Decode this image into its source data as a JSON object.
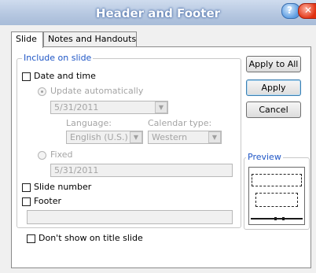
{
  "window": {
    "title": "Header and Footer"
  },
  "tabs": [
    {
      "label": "Slide",
      "active": true
    },
    {
      "label": "Notes and Handouts",
      "active": false
    }
  ],
  "include_group": {
    "legend": "Include on slide",
    "date_time": {
      "label": "Date and time",
      "checked": false,
      "update_auto_label": "Update automatically",
      "date_value": "5/31/2011",
      "language_label": "Language:",
      "language_value": "English (U.S.)",
      "calendar_label": "Calendar type:",
      "calendar_value": "Western",
      "fixed_label": "Fixed",
      "fixed_value": "5/31/2011"
    },
    "slide_number": {
      "label": "Slide number",
      "checked": false
    },
    "footer": {
      "label": "Footer",
      "checked": false,
      "value": ""
    }
  },
  "dont_show_title": {
    "label": "Don't show on title slide",
    "checked": false
  },
  "buttons": {
    "apply_all": "Apply to All",
    "apply": "Apply",
    "cancel": "Cancel"
  },
  "preview": {
    "legend": "Preview"
  },
  "colors": {
    "legend": "#1f56c6",
    "disabled": "#a4a4a4",
    "default_button_border": "#3c7fb1"
  },
  "icons": [
    "help-icon",
    "close-icon",
    "dropdown-arrow-icon"
  ]
}
